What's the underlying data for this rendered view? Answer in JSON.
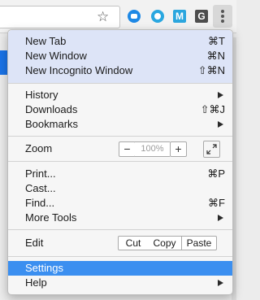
{
  "menu": {
    "items": [
      {
        "label": "New Tab",
        "shortcut": "⌘T"
      },
      {
        "label": "New Window",
        "shortcut": "⌘N"
      },
      {
        "label": "New Incognito Window",
        "shortcut": "⇧⌘N"
      },
      {
        "label": "History",
        "shortcut": ""
      },
      {
        "label": "Downloads",
        "shortcut": "⇧⌘J"
      },
      {
        "label": "Bookmarks",
        "shortcut": ""
      },
      {
        "label": "Print...",
        "shortcut": "⌘P"
      },
      {
        "label": "Cast...",
        "shortcut": ""
      },
      {
        "label": "Find...",
        "shortcut": "⌘F"
      },
      {
        "label": "More Tools",
        "shortcut": ""
      },
      {
        "label": "Settings",
        "shortcut": ""
      },
      {
        "label": "Help",
        "shortcut": ""
      }
    ],
    "zoom": {
      "label": "Zoom",
      "minus": "−",
      "level": "100%",
      "plus": "+"
    },
    "edit": {
      "label": "Edit",
      "cut": "Cut",
      "copy": "Copy",
      "paste": "Paste"
    }
  },
  "toolbar": {
    "star": "☆",
    "extensions": [
      {
        "icon": "blue-chat-extension-icon",
        "color": "#1e88e5"
      },
      {
        "icon": "blue-circle-extension-icon",
        "color": "#29a7e0"
      },
      {
        "icon": "m-extension-icon",
        "label": "M",
        "color": "#2ba6de"
      },
      {
        "icon": "g-extension-icon",
        "label": "G",
        "color": "#4d4d4d"
      }
    ]
  },
  "colors": {
    "selected": "#3b8ff0",
    "highlight": "#dde4f7"
  }
}
